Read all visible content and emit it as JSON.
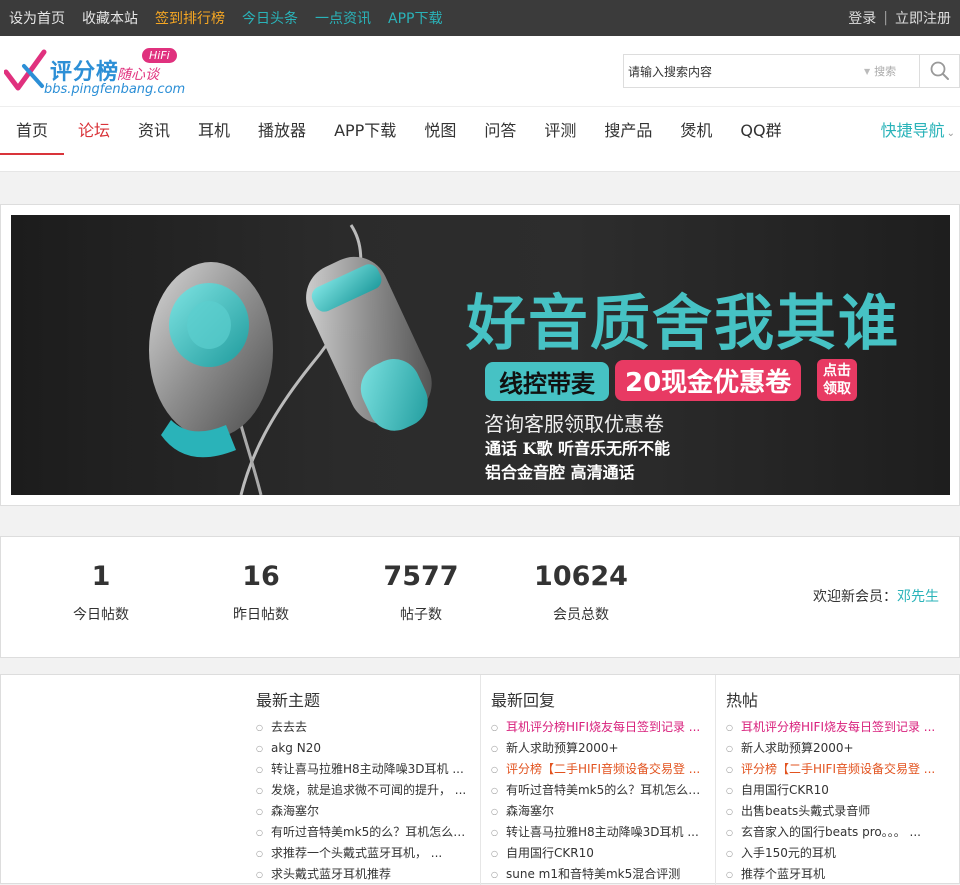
{
  "topbar": {
    "links": [
      {
        "label": "设为首页",
        "color": "#e6e6e6"
      },
      {
        "label": "收藏本站",
        "color": "#e6e6e6"
      },
      {
        "label": "签到排行榜",
        "color": "#f5a623"
      },
      {
        "label": "今日头条",
        "color": "#2ab3b9"
      },
      {
        "label": "一点资讯",
        "color": "#2ab3b9"
      },
      {
        "label": "APP下载",
        "color": "#2ab3b9"
      }
    ],
    "login": "登录",
    "sep": "|",
    "register": "立即注册"
  },
  "logo": {
    "name": "评分榜",
    "slogan": "随心谈",
    "badge": "HiFi",
    "domain": "bbs.pingfenbang.com"
  },
  "search": {
    "value": "请输入搜索内容",
    "scope": "搜索"
  },
  "nav": {
    "items": [
      "首页",
      "论坛",
      "资讯",
      "耳机",
      "播放器",
      "APP下载",
      "悦图",
      "问答",
      "评测",
      "搜产品",
      "煲机",
      "QQ群"
    ],
    "active": "首页",
    "highlight": "论坛",
    "quick": "快捷导航"
  },
  "banner": {
    "headline": "好音质舍我其谁",
    "tag1": "线控带麦",
    "tag2": "20现金优惠卷",
    "tag3_line1": "点击",
    "tag3_line2": "领取",
    "sub1": "咨询客服领取优惠卷",
    "sub2": "通话 K歌 听音乐无所不能",
    "sub3": "铝合金音腔 高清通话"
  },
  "stats": [
    {
      "num": "1",
      "label": "今日帖数"
    },
    {
      "num": "16",
      "label": "昨日帖数"
    },
    {
      "num": "7577",
      "label": "帖子数"
    },
    {
      "num": "10624",
      "label": "会员总数"
    }
  ],
  "welcome": {
    "prefix": "欢迎新会员：",
    "name": "邓先生"
  },
  "lists": {
    "latest_topics": {
      "title": "最新主题",
      "items": [
        {
          "text": "去去去",
          "style": ""
        },
        {
          "text": "akg N20",
          "style": ""
        },
        {
          "text": "转让喜马拉雅H8主动降噪3D耳机 ...",
          "style": ""
        },
        {
          "text": "发烧，就是追求微不可闻的提升， ...",
          "style": ""
        },
        {
          "text": "森海塞尔",
          "style": ""
        },
        {
          "text": "有听过音特美mk5的么？耳机怎么 ...",
          "style": ""
        },
        {
          "text": "求推荐一个头戴式蓝牙耳机， ...",
          "style": ""
        },
        {
          "text": "求头戴式蓝牙耳机推荐",
          "style": ""
        }
      ]
    },
    "latest_replies": {
      "title": "最新回复",
      "items": [
        {
          "text": "耳机评分榜HIFI烧友每日签到记录 ...",
          "style": "pink"
        },
        {
          "text": "新人求助预算2000+",
          "style": ""
        },
        {
          "text": "评分榜【二手HIFI音频设备交易登 ...",
          "style": "orange"
        },
        {
          "text": "有听过音特美mk5的么？耳机怎么 ...",
          "style": ""
        },
        {
          "text": "森海塞尔",
          "style": ""
        },
        {
          "text": "转让喜马拉雅H8主动降噪3D耳机 ...",
          "style": ""
        },
        {
          "text": "自用国行CKR10",
          "style": ""
        },
        {
          "text": "sune m1和音特美mk5混合评测",
          "style": ""
        }
      ]
    },
    "hot_posts": {
      "title": "热帖",
      "items": [
        {
          "text": "耳机评分榜HIFI烧友每日签到记录 ...",
          "style": "pink"
        },
        {
          "text": "新人求助预算2000+",
          "style": ""
        },
        {
          "text": "评分榜【二手HIFI音频设备交易登 ...",
          "style": "orange"
        },
        {
          "text": "自用国行CKR10",
          "style": ""
        },
        {
          "text": "出售beats头戴式录音师",
          "style": ""
        },
        {
          "text": "玄音家入的国行beats pro。。。 ...",
          "style": ""
        },
        {
          "text": "入手150元的耳机",
          "style": ""
        },
        {
          "text": "推荐个蓝牙耳机",
          "style": ""
        }
      ]
    }
  }
}
